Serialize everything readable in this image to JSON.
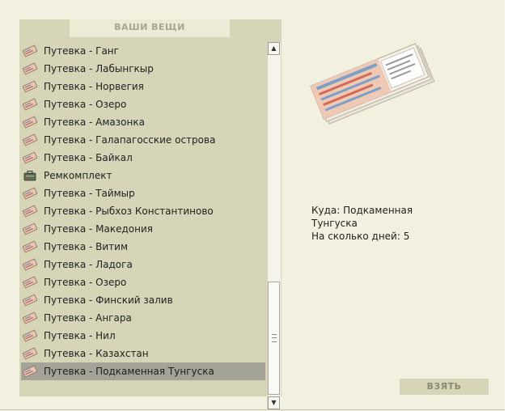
{
  "panel": {
    "title": "ВАШИ ВЕЩИ"
  },
  "items": [
    {
      "label": "Путевка - Ганг",
      "icon": "ticket-icon"
    },
    {
      "label": "Путевка - Лабынгкыр",
      "icon": "ticket-icon"
    },
    {
      "label": "Путевка - Норвегия",
      "icon": "ticket-icon"
    },
    {
      "label": "Путевка - Озеро",
      "icon": "ticket-icon"
    },
    {
      "label": "Путевка - Амазонка",
      "icon": "ticket-icon"
    },
    {
      "label": "Путевка - Галапагосские острова",
      "icon": "ticket-icon"
    },
    {
      "label": "Путевка - Байкал",
      "icon": "ticket-icon"
    },
    {
      "label": "Ремкомплект",
      "icon": "repair-kit-icon"
    },
    {
      "label": "Путевка - Таймыр",
      "icon": "ticket-icon"
    },
    {
      "label": "Путевка - Рыбхоз Константиново",
      "icon": "ticket-icon"
    },
    {
      "label": "Путевка - Македония",
      "icon": "ticket-icon"
    },
    {
      "label": "Путевка - Витим",
      "icon": "ticket-icon"
    },
    {
      "label": "Путевка - Ладога",
      "icon": "ticket-icon"
    },
    {
      "label": "Путевка - Озеро",
      "icon": "ticket-icon"
    },
    {
      "label": "Путевка - Финский залив",
      "icon": "ticket-icon"
    },
    {
      "label": "Путевка - Ангара",
      "icon": "ticket-icon"
    },
    {
      "label": "Путевка - Нил",
      "icon": "ticket-icon"
    },
    {
      "label": "Путевка - Казахстан",
      "icon": "ticket-icon"
    },
    {
      "label": "Путевка - Подкаменная Тунгуска",
      "icon": "ticket-icon",
      "selected": true
    }
  ],
  "details": {
    "destination": "Куда: Подкаменная Тунгуска",
    "days": "На сколько дней: 5"
  },
  "buttons": {
    "take": "ВЗЯТЬ"
  },
  "colors": {
    "background": "#f2f0de",
    "panel": "#d6d5b7",
    "selected_row": "#a3a397"
  }
}
